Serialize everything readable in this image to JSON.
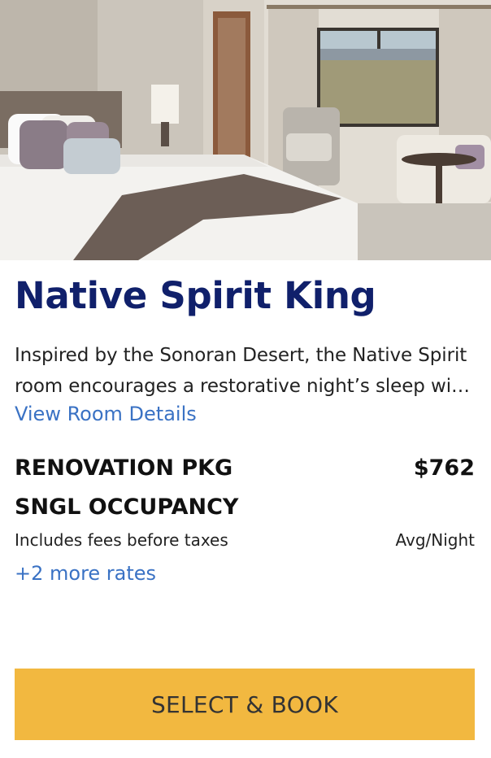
{
  "room": {
    "image_alt": "Native Spirit King room photo",
    "title": "Native Spirit King",
    "description": "Inspired by the Sonoran Desert, the Native Spirit room encourages a restorative night’s sleep with soft earth tones and desert views.",
    "details_link": "View Room Details"
  },
  "rate": {
    "name_line1": "RENOVATION PKG",
    "name_line2": "SNGL OCCUPANCY",
    "price": "$762",
    "fees_note": "Includes fees before taxes",
    "per": "Avg/Night",
    "more_rates": "+2 more rates"
  },
  "actions": {
    "book_label": "SELECT & BOOK"
  },
  "colors": {
    "title": "#10206b",
    "link": "#3a72c4",
    "button": "#f2b840"
  }
}
